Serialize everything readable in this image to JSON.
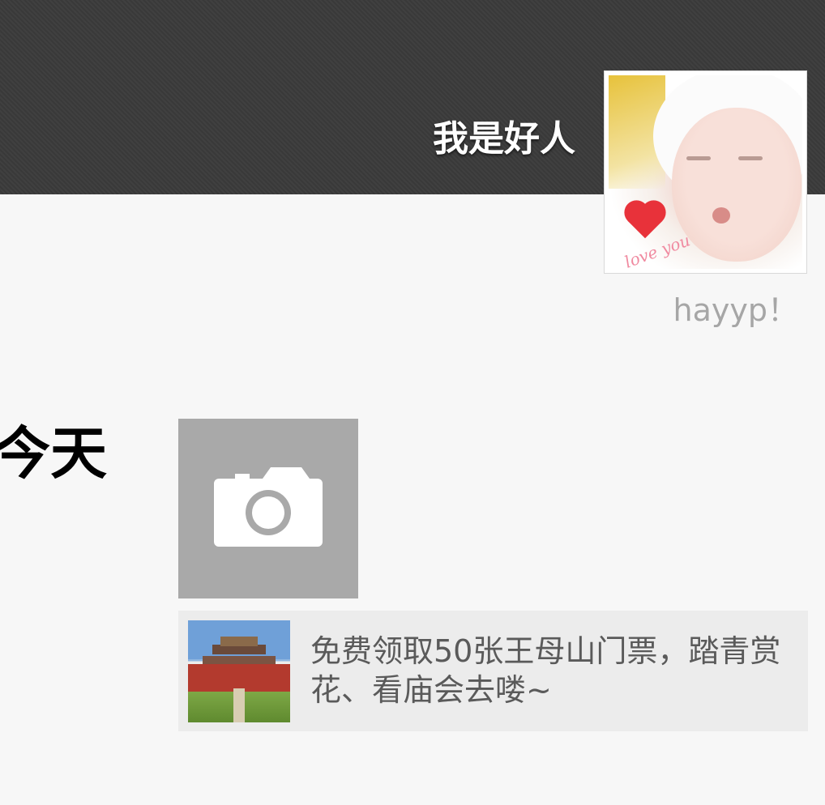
{
  "profile": {
    "nickname": "我是好人",
    "signature": "hayyp！",
    "avatar_icon": "baby-avatar",
    "avatar_text": "love you"
  },
  "timeline": {
    "day_label": "今天",
    "camera_icon": "camera-icon",
    "share_card": {
      "thumbnail": "temple-photo",
      "text": "免费领取50张王母山门票，踏青赏花、看庙会去喽~"
    }
  },
  "colors": {
    "cover_bg": "#3b3b3b",
    "page_bg": "#f7f7f7",
    "camera_tile_bg": "#a9a9a9",
    "share_card_bg": "#ececec",
    "signature_text": "#a6a6a6"
  }
}
